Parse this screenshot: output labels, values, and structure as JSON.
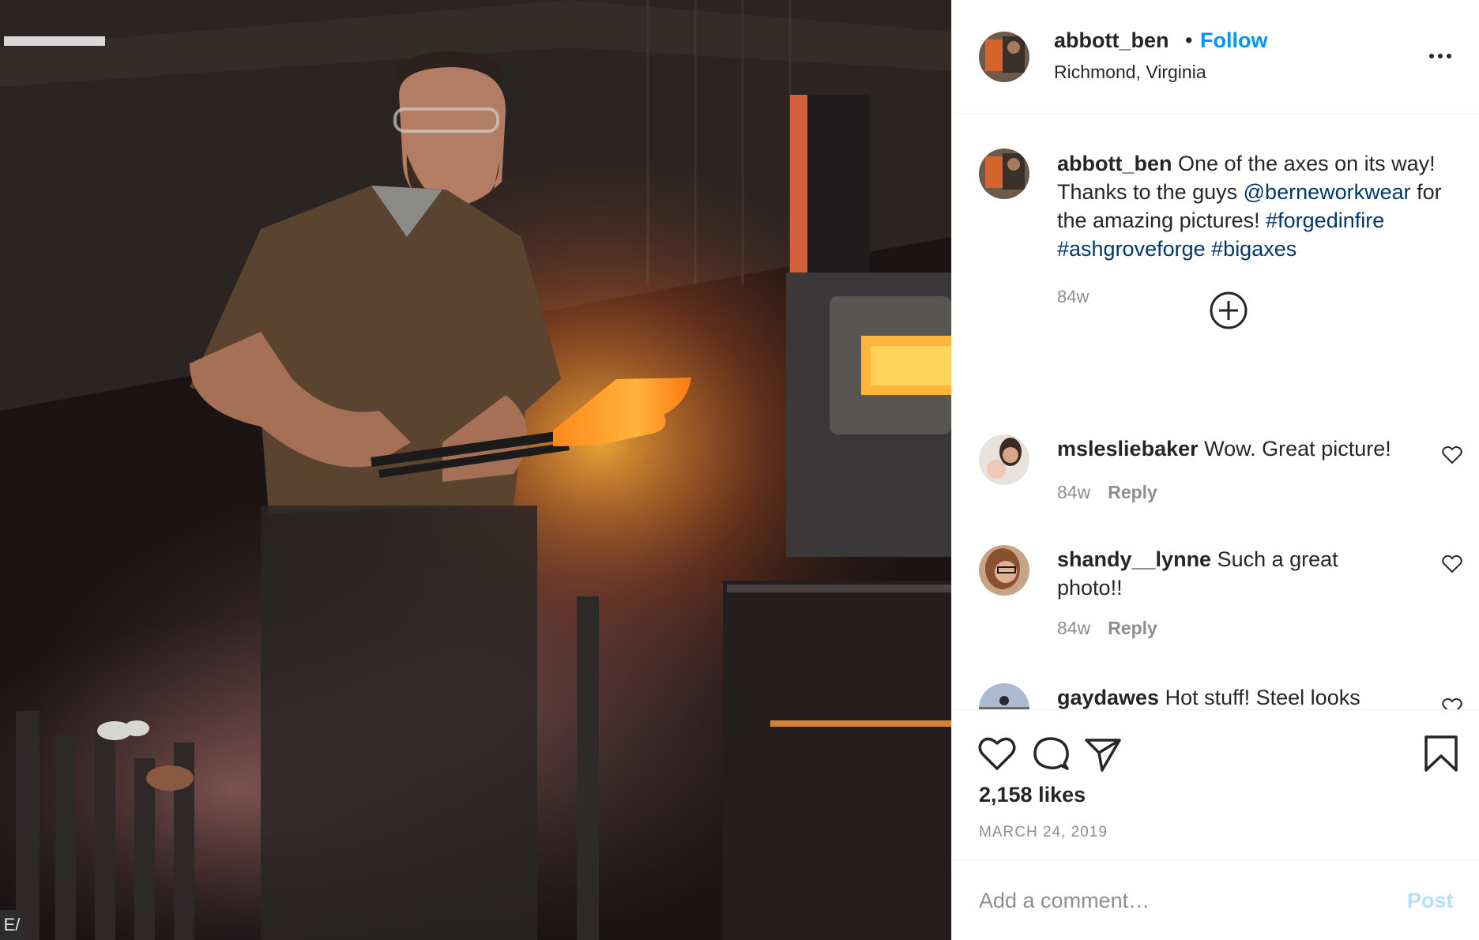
{
  "post": {
    "author": "abbott_ben",
    "location": "Richmond, Virginia",
    "follow_label": "Follow",
    "dot": "•"
  },
  "caption": {
    "username": "abbott_ben",
    "text_1": " One of the axes on its way! Thanks to the guys ",
    "mention": "@berneworkwear",
    "text_2": " for the amazing pictures! ",
    "hashtags": [
      "#forgedinfire",
      "#ashgroveforge",
      "#bigaxes"
    ],
    "time": "84w"
  },
  "comments": [
    {
      "username": "mslesliebaker",
      "text": " Wow. Great picture!",
      "time": "84w",
      "reply_label": "Reply"
    },
    {
      "username": "shandy__lynne",
      "text": " Such a great photo!!",
      "time": "84w",
      "reply_label": "Reply"
    },
    {
      "username": "gaydawes",
      "text": " Hot stuff! Steel looks"
    }
  ],
  "actions": {
    "likes": "2,158 likes",
    "date": "MARCH 24, 2019"
  },
  "add_comment": {
    "placeholder": "Add a comment…",
    "post_label": "Post"
  },
  "photo": {
    "side_tab": "E/"
  },
  "icons": {
    "load_more": "plus-circle-icon",
    "like": "heart-icon",
    "comment": "speech-bubble-icon",
    "share": "paper-plane-icon",
    "save": "bookmark-icon",
    "more": "more-options-icon"
  },
  "colors": {
    "accent": "#0095f6",
    "link": "#00376b",
    "secondary_text": "#8e8e8e",
    "post_disabled": "#b2dffc"
  }
}
